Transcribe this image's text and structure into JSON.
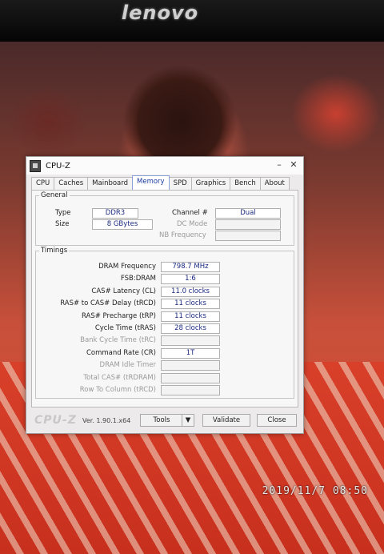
{
  "monitor": {
    "brand": "lenovo"
  },
  "photo": {
    "timestamp": "2019/11/7  08:50"
  },
  "window": {
    "title": "CPU-Z",
    "minimize": "–",
    "close": "✕",
    "tabs": [
      "CPU",
      "Caches",
      "Mainboard",
      "Memory",
      "SPD",
      "Graphics",
      "Bench",
      "About"
    ],
    "active_tab": "Memory"
  },
  "general": {
    "legend": "General",
    "type_label": "Type",
    "type_value": "DDR3",
    "size_label": "Size",
    "size_value": "8 GBytes",
    "channel_label": "Channel #",
    "channel_value": "Dual",
    "dc_mode_label": "DC Mode",
    "nb_freq_label": "NB Frequency"
  },
  "timings": {
    "legend": "Timings",
    "rows": [
      {
        "label": "DRAM Frequency",
        "value": "798.7 MHz",
        "dim": false
      },
      {
        "label": "FSB:DRAM",
        "value": "1:6",
        "dim": false
      },
      {
        "label": "CAS# Latency (CL)",
        "value": "11.0 clocks",
        "dim": false
      },
      {
        "label": "RAS# to CAS# Delay (tRCD)",
        "value": "11 clocks",
        "dim": false
      },
      {
        "label": "RAS# Precharge (tRP)",
        "value": "11 clocks",
        "dim": false
      },
      {
        "label": "Cycle Time (tRAS)",
        "value": "28 clocks",
        "dim": false
      },
      {
        "label": "Bank Cycle Time (tRC)",
        "value": "",
        "dim": true
      },
      {
        "label": "Command Rate (CR)",
        "value": "1T",
        "dim": false
      },
      {
        "label": "DRAM Idle Timer",
        "value": "",
        "dim": true
      },
      {
        "label": "Total CAS# (tRDRAM)",
        "value": "",
        "dim": true
      },
      {
        "label": "Row To Column (tRCD)",
        "value": "",
        "dim": true
      }
    ]
  },
  "footer": {
    "logo": "CPU-Z",
    "version": "Ver. 1.90.1.x64",
    "tools": "Tools",
    "tools_dropdown": "▼",
    "validate": "Validate",
    "close": "Close"
  }
}
